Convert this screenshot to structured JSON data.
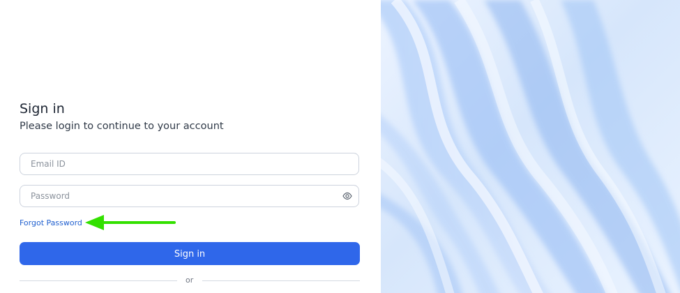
{
  "signin": {
    "title": "Sign in",
    "subtitle": "Please login to continue to your account",
    "email_placeholder": "Email ID",
    "password_placeholder": "Password",
    "forgot_password": "Forgot Password",
    "submit_label": "Sign in",
    "divider_text": "or"
  },
  "icons": {
    "password_toggle": "eye-icon",
    "annotation": "green-arrow-icon"
  },
  "colors": {
    "primary_button": "#2f67ea",
    "link": "#1f5fcf",
    "annotation_arrow": "#33e000",
    "panel_background": "#dce8fb"
  }
}
